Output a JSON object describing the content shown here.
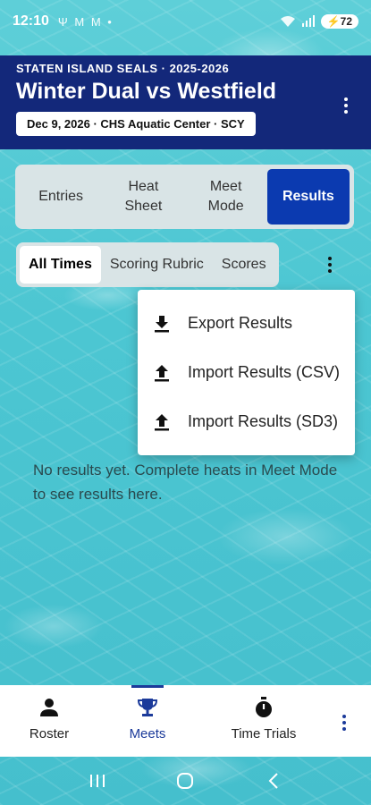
{
  "status_bar": {
    "time": "12:10",
    "notifications": "Ψ M M •",
    "battery": "72"
  },
  "header": {
    "team_season": "STATEN ISLAND SEALS · 2025-2026",
    "meet_title": "Winter Dual vs Westfield",
    "meet_info": "Dec 9, 2026 · CHS Aquatic Center · SCY"
  },
  "main_tabs": [
    {
      "label": "Entries",
      "active": false
    },
    {
      "label": "Heat\nSheet",
      "active": false
    },
    {
      "label": "Meet\nMode",
      "active": false
    },
    {
      "label": "Results",
      "active": true
    }
  ],
  "sub_tabs": [
    {
      "label": "All Times",
      "active": true
    },
    {
      "label": "Scoring Rubric",
      "active": false
    },
    {
      "label": "Scores",
      "active": false
    }
  ],
  "menu": {
    "items": [
      {
        "label": "Export Results",
        "icon": "download-icon"
      },
      {
        "label": "Import Results (CSV)",
        "icon": "upload-icon"
      },
      {
        "label": "Import Results (SD3)",
        "icon": "upload-icon"
      }
    ]
  },
  "empty_message": "No results yet. Complete heats in Meet Mode to see results here.",
  "bottom_nav": [
    {
      "label": "Roster",
      "icon": "person-icon",
      "active": false
    },
    {
      "label": "Meets",
      "icon": "trophy-icon",
      "active": true
    },
    {
      "label": "Time Trials",
      "icon": "stopwatch-icon",
      "active": false
    }
  ],
  "colors": {
    "header_bg": "#13287a",
    "accent": "#0b3ab0",
    "nav_active": "#1b3a9a"
  }
}
